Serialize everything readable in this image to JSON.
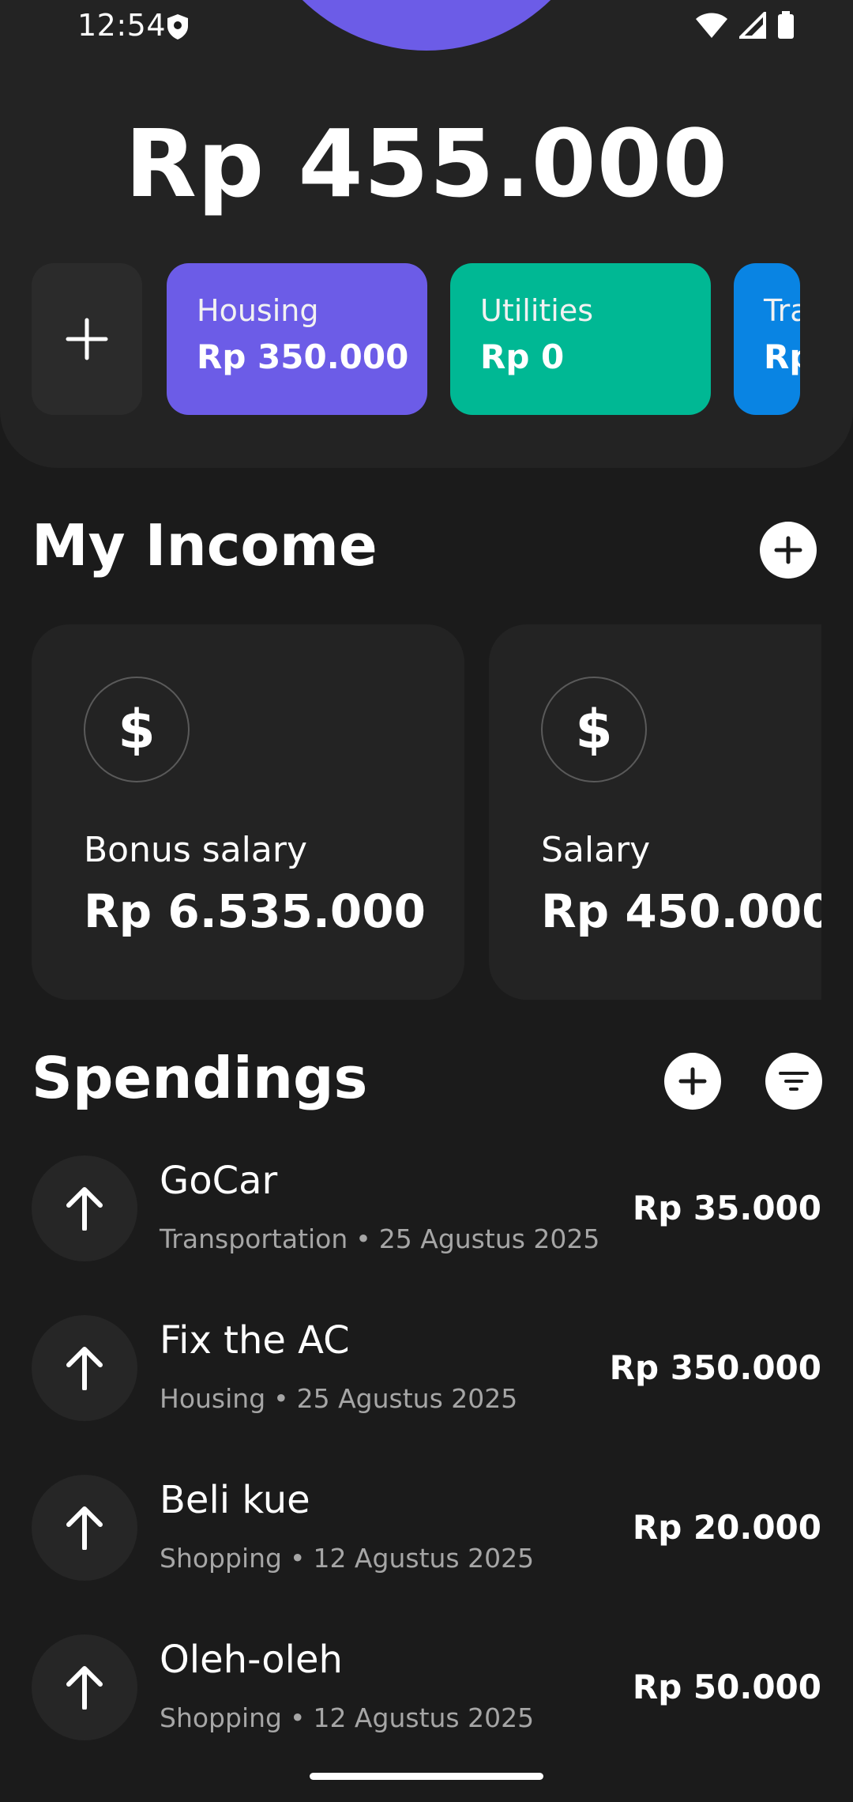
{
  "status_bar": {
    "time": "12:54"
  },
  "balance": {
    "total": "Rp 455.000"
  },
  "categories": [
    {
      "name": "Housing",
      "amount": "Rp 350.000",
      "color": "#6c5ce7"
    },
    {
      "name": "Utilities",
      "amount": "Rp 0",
      "color": "#00b894"
    },
    {
      "name": "Tra",
      "amount": "Rp",
      "color": "#0984e3"
    }
  ],
  "income": {
    "title": "My Income",
    "items": [
      {
        "name": "Bonus salary",
        "amount": "Rp 6.535.000",
        "icon": "$"
      },
      {
        "name": "Salary",
        "amount": "Rp 450.000",
        "icon": "$"
      }
    ]
  },
  "spendings": {
    "title": "Spendings",
    "items": [
      {
        "title": "GoCar",
        "category": "Transportation",
        "separator": "•",
        "date": "25 Agustus 2025",
        "amount": "Rp 35.000"
      },
      {
        "title": "Fix the AC",
        "category": "Housing",
        "separator": "•",
        "date": "25 Agustus 2025",
        "amount": "Rp 350.000"
      },
      {
        "title": "Beli kue",
        "category": "Shopping",
        "separator": "•",
        "date": "12 Agustus 2025",
        "amount": "Rp 20.000"
      },
      {
        "title": "Oleh-oleh",
        "category": "Shopping",
        "separator": "•",
        "date": "12 Agustus 2025",
        "amount": "Rp 50.000"
      }
    ]
  },
  "colors": {
    "background": "#1b1b1b",
    "panel": "#232323",
    "accent": "#6c5ce7"
  }
}
